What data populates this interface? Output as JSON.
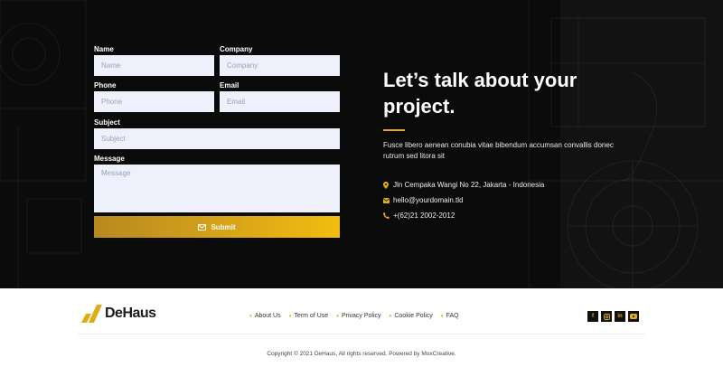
{
  "form": {
    "name_label": "Name",
    "name_placeholder": "Name",
    "company_label": "Company",
    "company_placeholder": "Company",
    "phone_label": "Phone",
    "phone_placeholder": "Phone",
    "email_label": "Email",
    "email_placeholder": "Email",
    "subject_label": "Subject",
    "subject_placeholder": "Subject",
    "message_label": "Message",
    "message_placeholder": "Message",
    "submit_label": "Submit"
  },
  "info": {
    "headline": "Let’s talk about your project.",
    "description": "Fusce libero aenean conubia vitae bibendum accumsan convallis donec rutrum sed litora sit",
    "address": "Jln Cempaka Wangi No 22, Jakarta - Indonesia",
    "email": "hello@yourdomain.tld",
    "phone": "+(62)21 2002-2012"
  },
  "footer": {
    "logo_text": "DeHaus",
    "nav": [
      "About Us",
      "Term of Use",
      "Privacy Policy",
      "Cookie Policy",
      "FAQ"
    ],
    "socials": [
      "facebook-icon",
      "instagram-icon",
      "linkedin-icon",
      "youtube-icon"
    ],
    "copyright": "Copyright © 2021 DeHaus, All rights reserved. Powered by MoxCreative."
  },
  "colors": {
    "accent": "#e1ad14",
    "dark_bg": "#0b0b0b",
    "input_bg": "#eef0fb"
  }
}
